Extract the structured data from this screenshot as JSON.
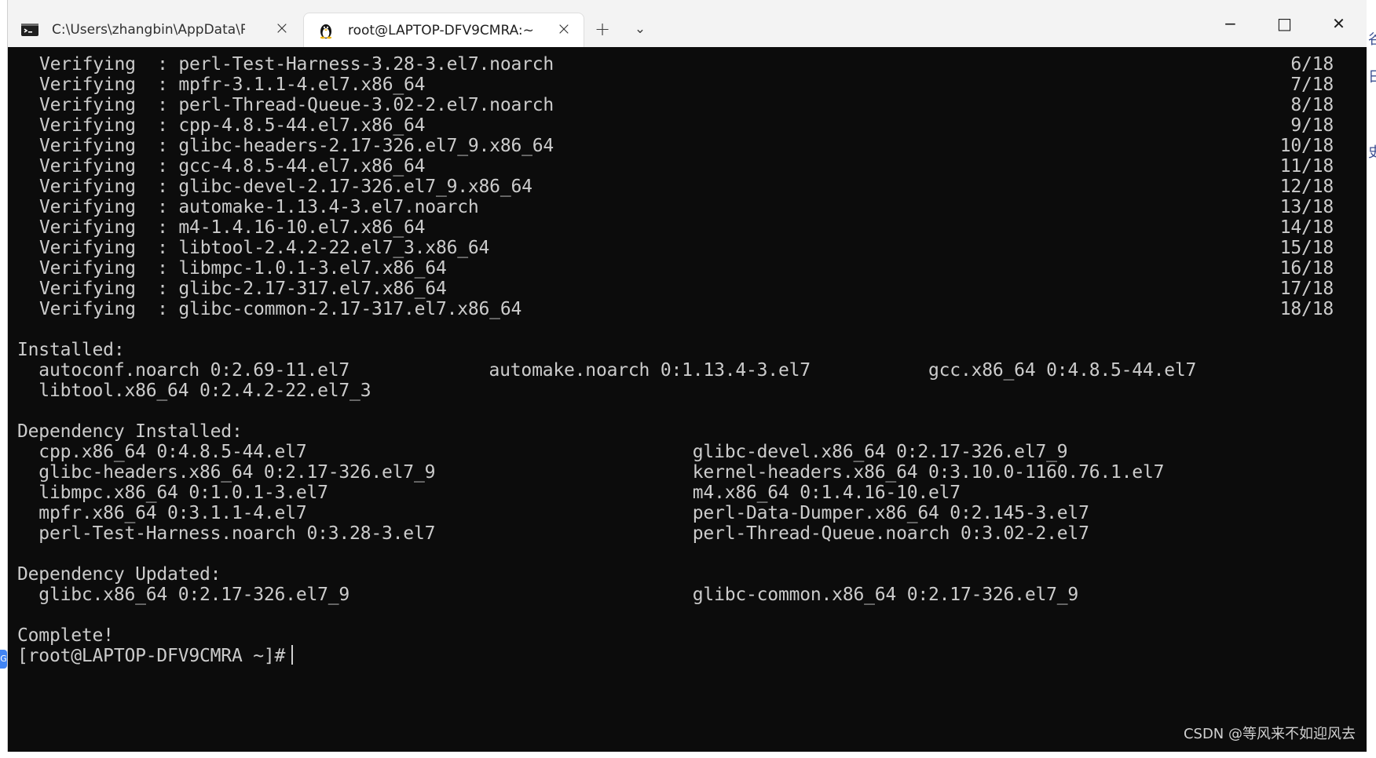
{
  "window": {
    "tabs": [
      {
        "title": "C:\\Users\\zhangbin\\AppData\\R",
        "icon": "terminal-icon"
      },
      {
        "title": "root@LAPTOP-DFV9CMRA:~",
        "icon": "linux-penguin-icon"
      }
    ],
    "new_tab_label": "+",
    "dropdown_label": "⌄",
    "controls": {
      "minimize": "−",
      "maximize": "□",
      "close": "✕"
    }
  },
  "terminal": {
    "verifying": [
      {
        "left": "Verifying  : perl-Test-Harness-3.28-3.el7.noarch",
        "right": "6/18"
      },
      {
        "left": "Verifying  : mpfr-3.1.1-4.el7.x86_64",
        "right": "7/18"
      },
      {
        "left": "Verifying  : perl-Thread-Queue-3.02-2.el7.noarch",
        "right": "8/18"
      },
      {
        "left": "Verifying  : cpp-4.8.5-44.el7.x86_64",
        "right": "9/18"
      },
      {
        "left": "Verifying  : glibc-headers-2.17-326.el7_9.x86_64",
        "right": "10/18"
      },
      {
        "left": "Verifying  : gcc-4.8.5-44.el7.x86_64",
        "right": "11/18"
      },
      {
        "left": "Verifying  : glibc-devel-2.17-326.el7_9.x86_64",
        "right": "12/18"
      },
      {
        "left": "Verifying  : automake-1.13.4-3.el7.noarch",
        "right": "13/18"
      },
      {
        "left": "Verifying  : m4-1.4.16-10.el7.x86_64",
        "right": "14/18"
      },
      {
        "left": "Verifying  : libtool-2.4.2-22.el7_3.x86_64",
        "right": "15/18"
      },
      {
        "left": "Verifying  : libmpc-1.0.1-3.el7.x86_64",
        "right": "16/18"
      },
      {
        "left": "Verifying  : glibc-2.17-317.el7.x86_64",
        "right": "17/18"
      },
      {
        "left": "Verifying  : glibc-common-2.17-317.el7.x86_64",
        "right": "18/18"
      }
    ],
    "installed_header": "Installed:",
    "installed_1": "  autoconf.noarch 0:2.69-11.el7             automake.noarch 0:1.13.4-3.el7           gcc.x86_64 0:4.8.5-44.el7",
    "installed_2": "  libtool.x86_64 0:2.4.2-22.el7_3",
    "dep_installed_header": "Dependency Installed:",
    "dep_installed": [
      "  cpp.x86_64 0:4.8.5-44.el7                                    glibc-devel.x86_64 0:2.17-326.el7_9",
      "  glibc-headers.x86_64 0:2.17-326.el7_9                        kernel-headers.x86_64 0:3.10.0-1160.76.1.el7",
      "  libmpc.x86_64 0:1.0.1-3.el7                                  m4.x86_64 0:1.4.16-10.el7",
      "  mpfr.x86_64 0:3.1.1-4.el7                                    perl-Data-Dumper.x86_64 0:2.145-3.el7",
      "  perl-Test-Harness.noarch 0:3.28-3.el7                        perl-Thread-Queue.noarch 0:3.02-2.el7"
    ],
    "dep_updated_header": "Dependency Updated:",
    "dep_updated_1": "  glibc.x86_64 0:2.17-326.el7_9                                glibc-common.x86_64 0:2.17-326.el7_9",
    "complete": "Complete!",
    "prompt": "[root@LAPTOP-DFV9CMRA ~]#"
  },
  "watermark": "CSDN @等风来不如迎风去",
  "edge_texts": [
    "谷",
    "日",
    "史"
  ],
  "left_badge": "G"
}
